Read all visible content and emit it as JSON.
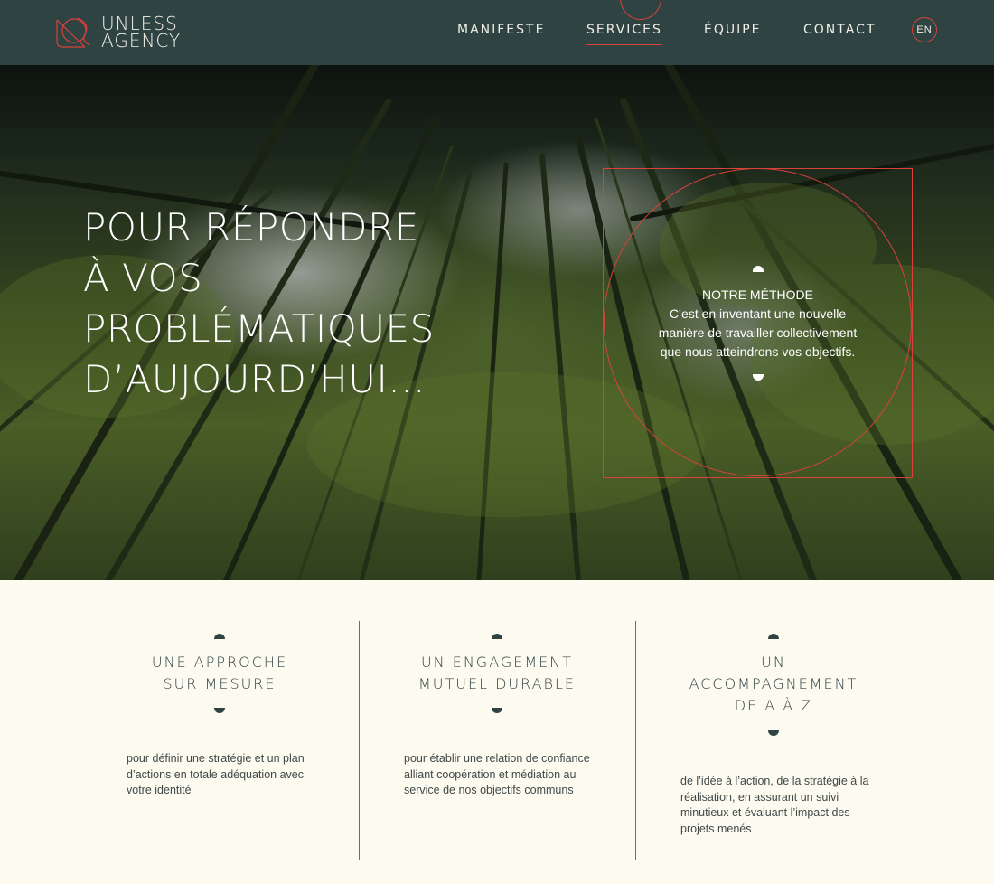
{
  "brand": {
    "line1": "UNLESS",
    "line2": "AGENCY"
  },
  "nav": {
    "items": [
      {
        "label": "MANIFESTE"
      },
      {
        "label": "SERVICES"
      },
      {
        "label": "ÉQUIPE"
      },
      {
        "label": "CONTACT"
      }
    ],
    "active": "SERVICES",
    "lang": "EN"
  },
  "colors": {
    "nav_bg": "#2f4342",
    "accent": "#d9423b",
    "page_bg": "#fdfaf0"
  },
  "hero": {
    "title_lines": [
      "POUR RÉPONDRE",
      "À VOS",
      "PROBLÉMATIQUES",
      "D’AUJOURD’HUI..."
    ],
    "method": {
      "heading": "NOTRE MÉTHODE",
      "lines": [
        "C’est en inventant une nouvelle",
        "manière de travailler collectivement",
        "que nous atteindrons vos objectifs."
      ]
    }
  },
  "features": [
    {
      "title_lines": [
        "UNE APPROCHE",
        "SUR MESURE"
      ],
      "body_lines": [
        "pour définir une stratégie et un plan",
        "d’actions en totale adéquation avec",
        "votre identité"
      ]
    },
    {
      "title_lines": [
        "UN ENGAGEMENT",
        "MUTUEL DURABLE"
      ],
      "body_lines": [
        "pour établir une relation de confiance",
        "alliant coopération et médiation au",
        "service de nos objectifs communs"
      ]
    },
    {
      "title_lines": [
        "UN",
        "ACCOMPAGNEMENT",
        "DE A À Z"
      ],
      "body_lines": [
        "de l’idée à l’action, de la stratégie à la",
        "réalisation, en assurant un suivi",
        "minutieux et évaluant l’impact des",
        "projets menés"
      ]
    }
  ]
}
